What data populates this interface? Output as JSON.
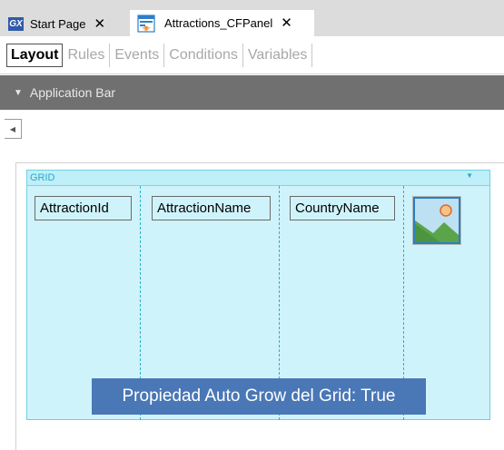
{
  "tabs": {
    "start_page": {
      "label": "Start Page",
      "icon_text": "GX",
      "close": "✕"
    },
    "active_doc": {
      "label": "Attractions_CFPanel",
      "close": "✕"
    }
  },
  "designer_tabs": [
    "Layout",
    "Rules",
    "Events",
    "Conditions",
    "Variables"
  ],
  "app_bar": {
    "label": "Application Bar",
    "caret": "▼"
  },
  "collapse": {
    "glyph": "◀"
  },
  "grid": {
    "title": "GRID",
    "menu_glyph": "▼",
    "columns": [
      "AttractionId",
      "AttractionName",
      "CountryName"
    ]
  },
  "callout": {
    "text": "Propiedad Auto Grow del Grid: True"
  },
  "colors": {
    "grid_fill": "#cff3fb",
    "grid_border": "#2ab1c9",
    "callout": "#4a77b6",
    "app_bar": "#707070"
  }
}
